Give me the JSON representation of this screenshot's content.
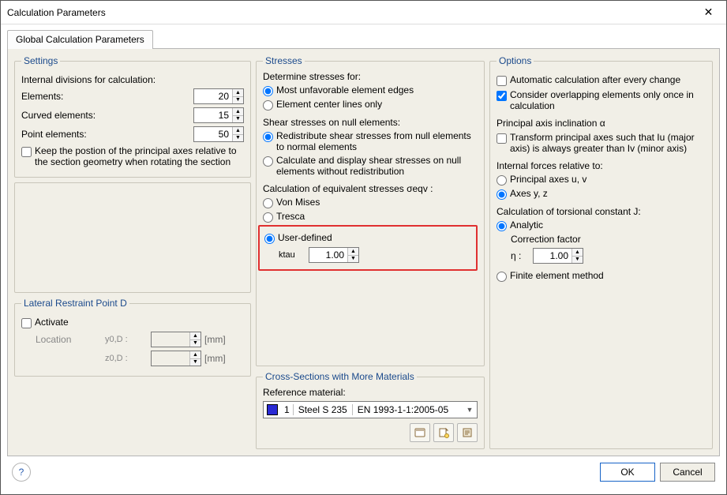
{
  "window": {
    "title": "Calculation Parameters"
  },
  "tabs": {
    "global": "Global Calculation Parameters"
  },
  "settings": {
    "legend": "Settings",
    "internal_div": "Internal divisions for calculation:",
    "elements_label": "Elements:",
    "elements_value": "20",
    "curved_label": "Curved elements:",
    "curved_value": "15",
    "point_label": "Point elements:",
    "point_value": "50",
    "keep_pos": "Keep the postion of the principal axes relative to the section geometry when rotating the section"
  },
  "lateral": {
    "legend": "Lateral Restraint Point D",
    "activate": "Activate",
    "location": "Location",
    "y0d": "y0,D :",
    "z0d": "z0,D :",
    "unit": "[mm]"
  },
  "stresses": {
    "legend": "Stresses",
    "determine": "Determine stresses for:",
    "opt1": "Most unfavorable element edges",
    "opt2": "Element center lines only",
    "shear_h": "Shear stresses on null elements:",
    "shear_opt1": "Redistribute shear stresses from null elements to normal elements",
    "shear_opt2": "Calculate and display shear stresses on null elements without redistribution",
    "eqv_h": "Calculation of equivalent stresses σeqv :",
    "vm": "Von Mises",
    "tresca": "Tresca",
    "user": "User-defined",
    "ktau": "ktau",
    "ktau_value": "1.00"
  },
  "cross": {
    "legend": "Cross-Sections with More Materials",
    "ref": "Reference material:",
    "num": "1",
    "name": "Steel S 235",
    "std": "EN 1993-1-1:2005-05"
  },
  "options": {
    "legend": "Options",
    "auto": "Automatic calculation after every change",
    "overlap": "Consider overlapping elements only once in calculation",
    "pai_h": "Principal axis inclination α",
    "pai_chk": "Transform principal axes such that Iu (major axis) is always greater than Iv (minor axis)",
    "rel_h": "Internal forces relative to:",
    "rel_uv": "Principal axes u, v",
    "rel_yz": "Axes y, z",
    "tors_h": "Calculation of torsional constant J:",
    "analytic": "Analytic",
    "corr": "Correction factor",
    "eta": "η :",
    "eta_value": "1.00",
    "fem": "Finite element method"
  },
  "footer": {
    "ok": "OK",
    "cancel": "Cancel",
    "help": "?"
  }
}
